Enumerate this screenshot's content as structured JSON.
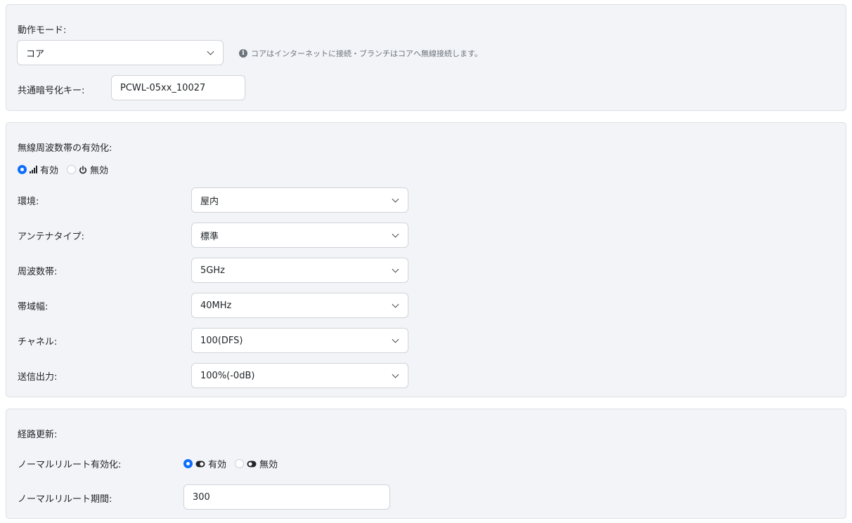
{
  "mode_section": {
    "mode_label": "動作モード:",
    "mode_value": "コア",
    "mode_hint": "コアはインターネットに接続・ブランチはコアへ無線接続します。",
    "key_label": "共通暗号化キー:",
    "key_value": "PCWL-05xx_10027"
  },
  "radio_section": {
    "band_enable_label": "無線周波数帯の有効化:",
    "band_enable_options": {
      "enabled": "有効",
      "disabled": "無効",
      "selected": "enabled"
    },
    "fields": [
      {
        "label": "環境:",
        "value": "屋内"
      },
      {
        "label": "アンテナタイプ:",
        "value": "標準"
      },
      {
        "label": "周波数帯:",
        "value": "5GHz"
      },
      {
        "label": "帯域幅:",
        "value": "40MHz"
      },
      {
        "label": "チャネル:",
        "value": "100(DFS)"
      },
      {
        "label": "送信出力:",
        "value": "100%(-0dB)"
      }
    ]
  },
  "route_section": {
    "title": "経路更新:",
    "reroute_label": "ノーマルリルート有効化:",
    "reroute_options": {
      "enabled": "有効",
      "disabled": "無効",
      "selected": "enabled"
    },
    "period_label": "ノーマルリルート期間:",
    "period_value": "300"
  },
  "icons": {
    "info": "info-circle-icon",
    "signal": "signal-bars-icon",
    "power": "power-icon",
    "toggle_on": "toggle-on-icon",
    "toggle_off": "toggle-off-icon",
    "chevron": "chevron-down-icon"
  },
  "colors": {
    "accent": "#0d6efd",
    "panel_bg": "#f3f4f7",
    "border": "#ced4da"
  }
}
